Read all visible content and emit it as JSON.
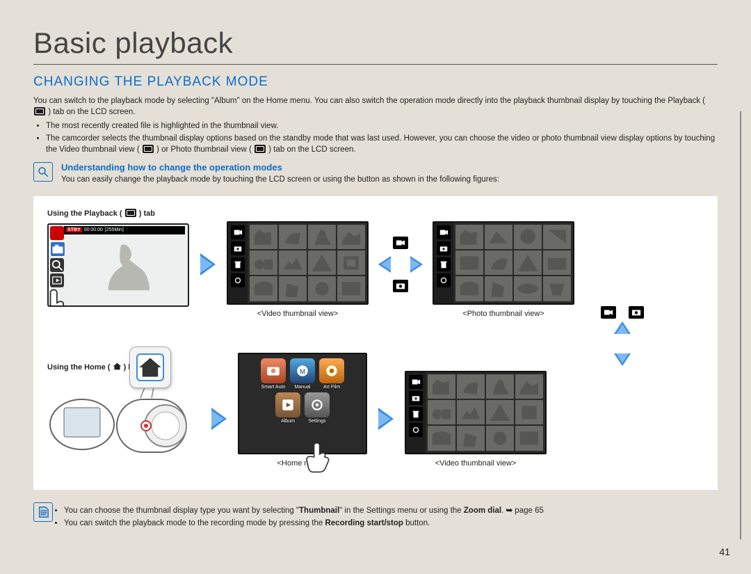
{
  "page_title": "Basic playback",
  "section_heading": "CHANGING THE PLAYBACK MODE",
  "intro": "You can switch to the playback mode by selecting \"Album\" on the Home menu. You can also switch the operation mode directly into the playback thumbnail display by touching the Playback (",
  "intro2": ") tab on the LCD screen.",
  "bullets": [
    "The most recently created file is highlighted in the thumbnail view.",
    "The camcorder selects the thumbnail display options based on the standby mode that was last used. However, you can choose the video or photo thumbnail view display options by touching the Video thumbnail view (",
    ") or Photo thumbnail view (",
    ") tab on the LCD screen."
  ],
  "sub_heading": "Understanding how to change the operation modes",
  "sub_body": "You can easily change the playback mode by touching the LCD screen or using the button as shown in the following figures:",
  "captions": {
    "using_playback_tab_pre": "Using the Playback (",
    "using_playback_tab_post": ") tab",
    "using_home_pre": "Using the Home (",
    "using_home_post": ") button",
    "video_thumb": "<Video thumbnail view>",
    "photo_thumb": "<Photo thumbnail view>",
    "home_menu": "<Home menu>"
  },
  "lcd": {
    "stby": "STBY",
    "time": "00:00:00",
    "remain": "[255Min]"
  },
  "home_apps": [
    "Smart Auto",
    "Manual",
    "Art Film",
    "Album",
    "Settings"
  ],
  "notes": [
    "You can choose the thumbnail display type you want by selecting \"Thumbnail\" in the Settings menu or using the Zoom dial. ➙ page 65",
    "You can switch the playback mode to the recording mode by pressing the Recording start/stop button."
  ],
  "page_number": "41"
}
